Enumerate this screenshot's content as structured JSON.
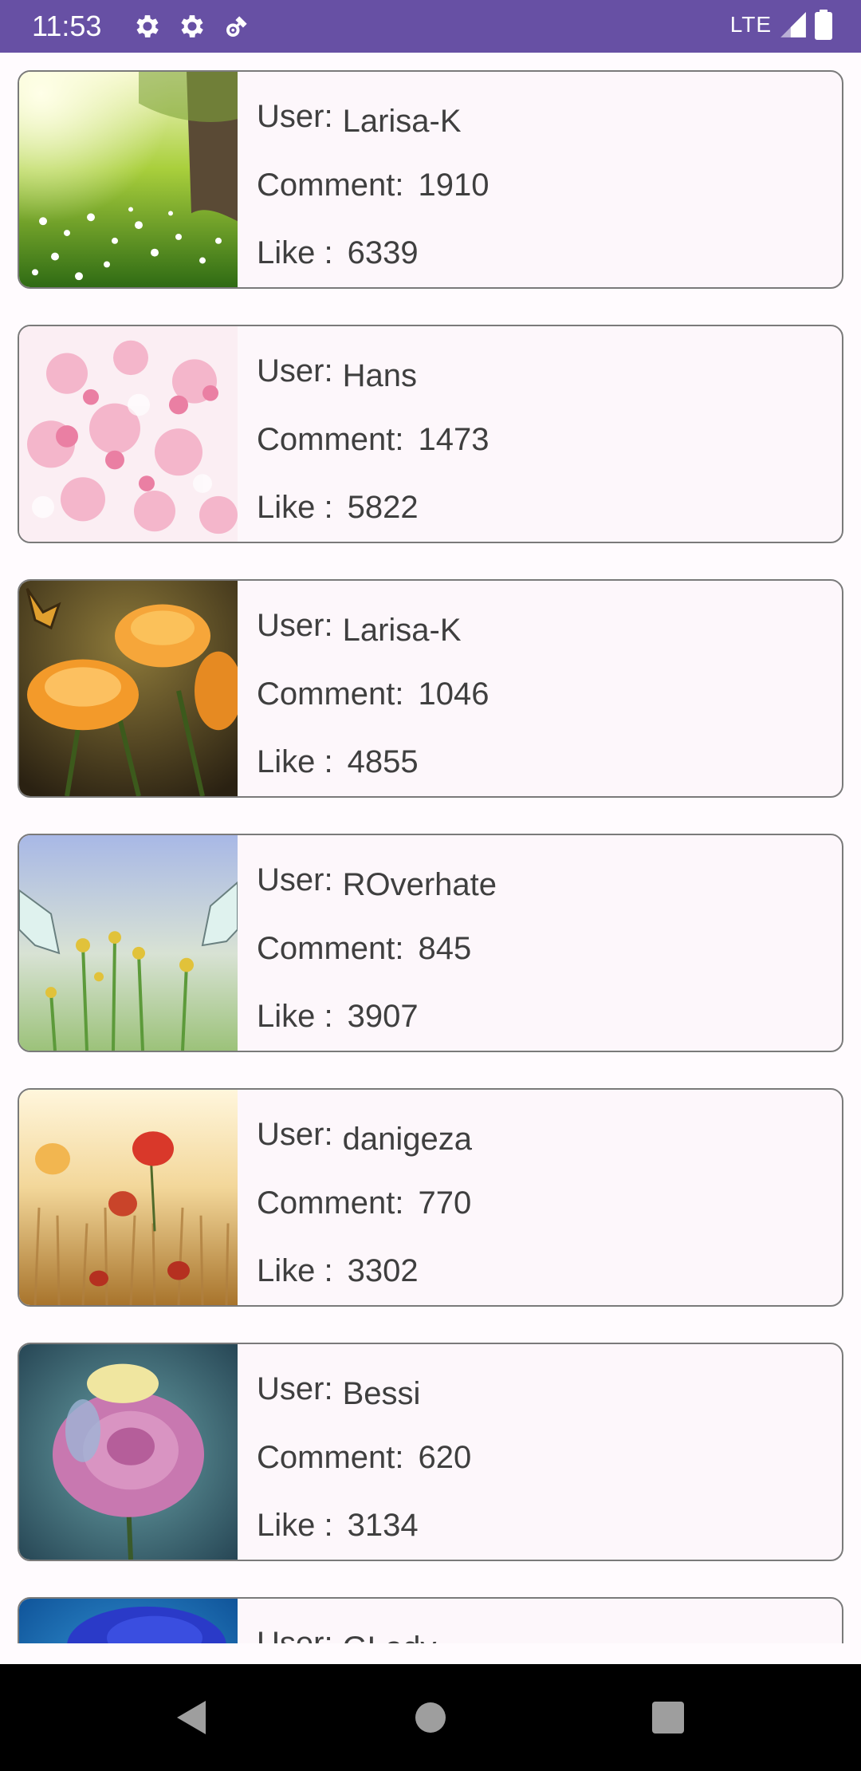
{
  "status_bar": {
    "time": "11:53",
    "network": "LTE",
    "icons": [
      "settings-icon",
      "settings-icon",
      "satellite-icon",
      "signal-icon",
      "battery-icon"
    ],
    "color": "#6750a4"
  },
  "labels": {
    "user": "User:",
    "comment": "Comment:",
    "like": "Like :"
  },
  "posts": [
    {
      "user": "Larisa-K",
      "comments": "1910",
      "likes": "6339",
      "image": "meadow-tree-image"
    },
    {
      "user": "Hans",
      "comments": "1473",
      "likes": "5822",
      "image": "cherry-blossom-image"
    },
    {
      "user": "Larisa-K",
      "comments": "1046",
      "likes": "4855",
      "image": "orange-roses-butterfly-image"
    },
    {
      "user": "ROverhate",
      "comments": "845",
      "likes": "3907",
      "image": "butterflies-flowers-image"
    },
    {
      "user": "danigeza",
      "comments": "770",
      "likes": "3302",
      "image": "poppy-field-image"
    },
    {
      "user": "Bessi",
      "comments": "620",
      "likes": "3134",
      "image": "pink-rose-image"
    },
    {
      "user": "GLady",
      "comments": "",
      "likes": "",
      "image": "blue-flower-image"
    }
  ],
  "nav": {
    "icons": [
      "back-icon",
      "home-icon",
      "recents-icon"
    ]
  }
}
